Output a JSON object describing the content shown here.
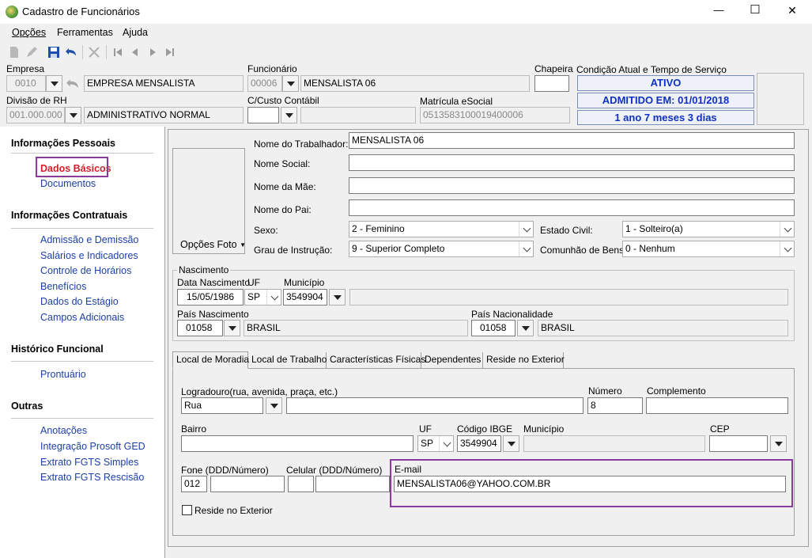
{
  "window": {
    "title": "Cadastro de Funcionários",
    "minimize": "—",
    "maximize": "☐",
    "close": "✕"
  },
  "menu": {
    "opcoes": "Opções",
    "ferramentas": "Ferramentas",
    "ajuda": "Ajuda"
  },
  "header": {
    "empresa_label": "Empresa",
    "empresa_code": "0010",
    "empresa_name": "EMPRESA MENSALISTA",
    "funcionario_label": "Funcionário",
    "funcionario_code": "00006",
    "funcionario_name": "MENSALISTA 06",
    "chapeira_label": "Chapeira",
    "chapeira_value": "",
    "condicao_label": "Condição Atual e Tempo de Serviço",
    "status_ativo": "ATIVO",
    "status_admitido": "ADMITIDO EM: 01/01/2018",
    "status_tempo": "1 ano 7 meses 3 dias",
    "divisao_label": "Divisão de RH",
    "divisao_code": "001.000.000",
    "divisao_name": "ADMINISTRATIVO NORMAL",
    "ccusto_label": "C/Custo Contábil",
    "ccusto_value": "",
    "matricula_label": "Matrícula eSocial",
    "matricula_value": "0513583100019400006"
  },
  "sidebar": {
    "sections": [
      {
        "title": "Informações Pessoais",
        "items": [
          "Dados Básicos",
          "Documentos"
        ]
      },
      {
        "title": "Informações Contratuais",
        "items": [
          "Admissão e Demissão",
          "Salários e Indicadores",
          "Controle de Horários",
          "Benefícios",
          "Dados do Estágio",
          "Campos Adicionais"
        ]
      },
      {
        "title": "Histórico Funcional",
        "items": [
          "Prontuário"
        ]
      },
      {
        "title": "Outras",
        "items": [
          "Anotações",
          "Integração Prosoft GED",
          "Extrato FGTS Simples",
          "Extrato FGTS Rescisão"
        ]
      }
    ]
  },
  "form": {
    "foto_button": "Opções Foto",
    "nome_trabalhador_label": "Nome do Trabalhador:",
    "nome_trabalhador": "MENSALISTA 06",
    "nome_social_label": "Nome Social:",
    "nome_social": "",
    "nome_mae_label": "Nome da Mãe:",
    "nome_mae": "",
    "nome_pai_label": "Nome do Pai:",
    "nome_pai": "",
    "sexo_label": "Sexo:",
    "sexo": "2 - Feminino",
    "estado_civil_label": "Estado Civil:",
    "estado_civil": "1 - Solteiro(a)",
    "grau_label": "Grau de Instrução:",
    "grau": "9 - Superior Completo",
    "comunhao_label": "Comunhão de Bens:",
    "comunhao": "0 - Nenhum"
  },
  "nascimento": {
    "group_label": "Nascimento",
    "data_label": "Data Nascimento",
    "data": "15/05/1986",
    "uf_label": "UF",
    "uf": "SP",
    "municipio_label": "Município",
    "municipio_code": "3549904",
    "municipio_name": "",
    "pais_nasc_label": "País Nascimento",
    "pais_nasc_code": "01058",
    "pais_nasc_name": "BRASIL",
    "pais_nac_label": "País Nacionalidade",
    "pais_nac_code": "01058",
    "pais_nac_name": "BRASIL"
  },
  "tabs": [
    "Local de Moradia",
    "Local de Trabalho",
    "Características Físicas",
    "Dependentes",
    "Reside no Exterior"
  ],
  "moradia": {
    "logradouro_label": "Logradouro(rua, avenida, praça, etc.)",
    "logradouro_tipo": "Rua",
    "logradouro": "",
    "numero_label": "Número",
    "numero": "8",
    "complemento_label": "Complemento",
    "complemento": "",
    "bairro_label": "Bairro",
    "bairro": "",
    "uf_label": "UF",
    "uf": "SP",
    "ibge_label": "Código IBGE",
    "ibge": "3549904",
    "municipio_label": "Município",
    "municipio": "",
    "cep_label": "CEP",
    "cep": "",
    "fone_label": "Fone (DDD/Número)",
    "fone_ddd": "012",
    "fone_num": "",
    "celular_label": "Celular (DDD/Número)",
    "celular_ddd": "",
    "celular_num": "",
    "email_label": "E-mail",
    "email": "MENSALISTA06@YAHOO.COM.BR",
    "reside_label": "Reside no Exterior"
  }
}
